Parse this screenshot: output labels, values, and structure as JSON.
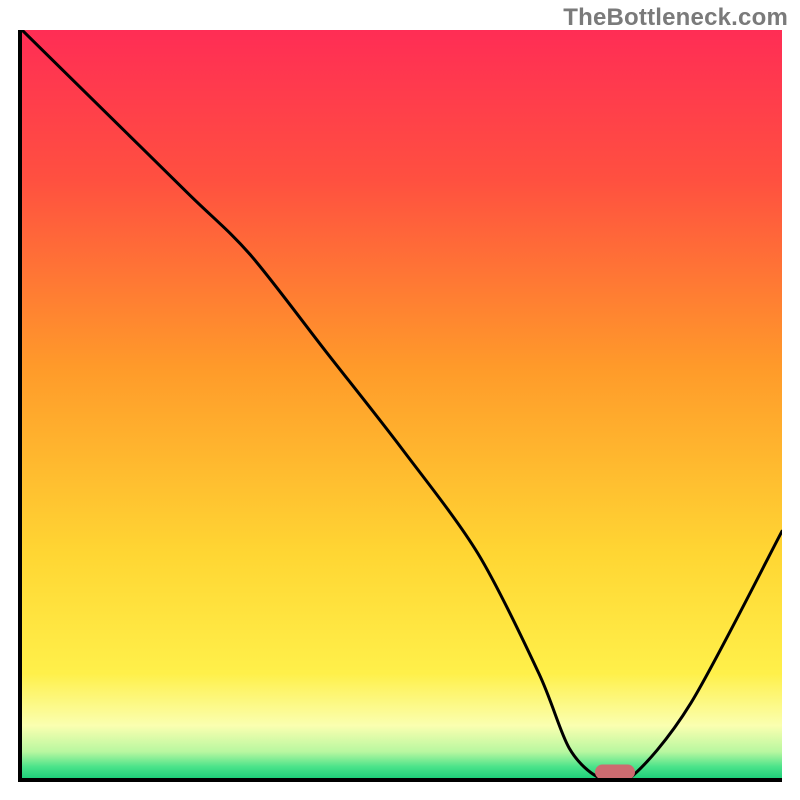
{
  "watermark": "TheBottleneck.com",
  "chart_data": {
    "type": "line",
    "title": "",
    "xlabel": "",
    "ylabel": "",
    "xlim": [
      0,
      100
    ],
    "ylim": [
      0,
      100
    ],
    "x": [
      0,
      10,
      22,
      30,
      40,
      50,
      60,
      68,
      72,
      76,
      80,
      88,
      100
    ],
    "values": [
      100,
      90,
      78,
      70,
      57,
      44,
      30,
      14,
      4,
      0,
      0,
      10,
      33
    ],
    "marker": {
      "x": 78,
      "y": 0
    },
    "gradient_stops": [
      {
        "pos": 0.0,
        "color": "#ff2d55"
      },
      {
        "pos": 0.2,
        "color": "#ff5040"
      },
      {
        "pos": 0.45,
        "color": "#ff9a2a"
      },
      {
        "pos": 0.7,
        "color": "#ffd633"
      },
      {
        "pos": 0.86,
        "color": "#fff04a"
      },
      {
        "pos": 0.93,
        "color": "#faffb0"
      },
      {
        "pos": 0.965,
        "color": "#b8f7a0"
      },
      {
        "pos": 0.985,
        "color": "#4be38a"
      },
      {
        "pos": 1.0,
        "color": "#1fcf7a"
      }
    ]
  }
}
